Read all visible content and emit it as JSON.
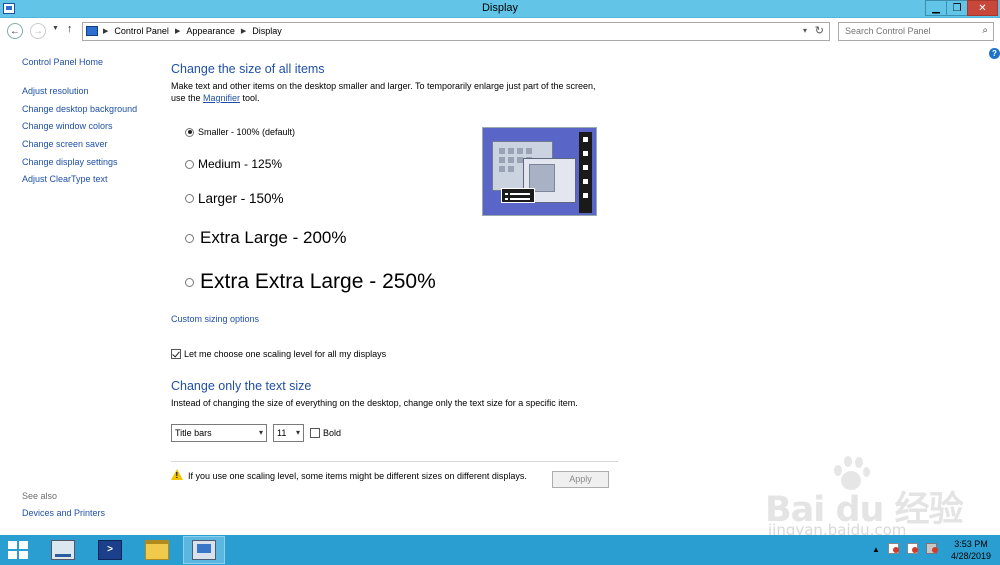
{
  "window": {
    "title": "Display",
    "controls": {
      "minimize": "▁",
      "maximize": "❐",
      "close": "✕"
    }
  },
  "address_bar": {
    "breadcrumbs": [
      "Control Panel",
      "Appearance",
      "Display"
    ],
    "search_placeholder": "Search Control Panel"
  },
  "sidebar": {
    "home": "Control Panel Home",
    "links": [
      "Adjust resolution",
      "Change desktop background",
      "Change window colors",
      "Change screen saver",
      "Change display settings",
      "Adjust ClearType text"
    ],
    "see_also_label": "See also",
    "see_also_links": [
      "Devices and Printers"
    ]
  },
  "main": {
    "size_heading": "Change the size of all items",
    "size_desc_before": "Make text and other items on the desktop smaller and larger. To temporarily enlarge just part of the screen, use the ",
    "magnifier_link": "Magnifier",
    "size_desc_after": " tool.",
    "options": [
      {
        "label": "Smaller - 100% (default)",
        "checked": true
      },
      {
        "label": "Medium - 125%",
        "checked": false
      },
      {
        "label": "Larger - 150%",
        "checked": false
      },
      {
        "label": "Extra Large - 200%",
        "checked": false
      },
      {
        "label": "Extra Extra Large - 250%",
        "checked": false
      }
    ],
    "custom_sizing_link": "Custom sizing options",
    "one_scaling_checkbox": {
      "label": "Let me choose one scaling level for all my displays",
      "checked": true
    },
    "text_heading": "Change only the text size",
    "text_desc": "Instead of changing the size of everything on the desktop, change only the text size for a specific item.",
    "item_select": "Title bars",
    "size_select": "11",
    "bold_checkbox": {
      "label": "Bold",
      "checked": false
    },
    "warning_text": "If you use one scaling level, some items might be different sizes on different displays.",
    "apply_button": "Apply"
  },
  "taskbar": {
    "apps": [
      "server-manager-icon",
      "powershell-icon",
      "file-explorer-icon",
      "control-panel-icon"
    ],
    "active_app": "control-panel-icon",
    "clock_time": "3:53 PM",
    "clock_date": "4/28/2019"
  },
  "watermark": {
    "brand": "Bai du 经验",
    "url": "jingyan.baidu.com"
  },
  "colors": {
    "accent": "#1f4fa8",
    "titlebar": "#62c5e8",
    "taskbar": "#2b9ed1"
  }
}
